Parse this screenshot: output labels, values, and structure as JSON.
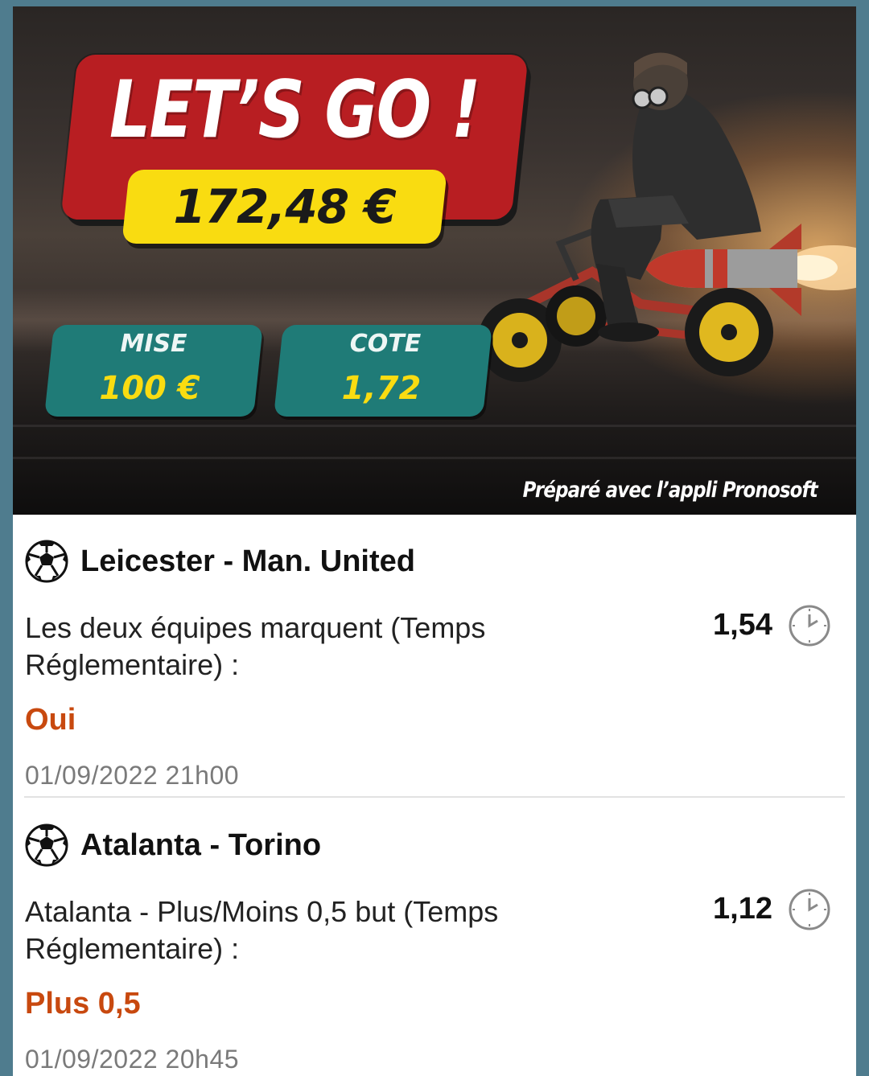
{
  "banner": {
    "headline": "LET’S GO !",
    "amount": "172,48 €",
    "stake": {
      "label": "MISE",
      "value": "100 €"
    },
    "odds": {
      "label": "COTE",
      "value": "1,72"
    },
    "credit": "Préparé avec l’appli Pronosoft",
    "colors": {
      "headline_bg": "#b81e22",
      "amount_bg": "#f9dc11",
      "tile_bg": "#1f7b77"
    }
  },
  "bets": [
    {
      "icon": "soccer-ball-icon",
      "match": "Leicester - Man. United",
      "market": "Les deux équipes marquent (Temps Réglementaire) :",
      "selection": "Oui",
      "odds": "1,54",
      "status_icon": "clock-icon",
      "datetime": "01/09/2022 21h00"
    },
    {
      "icon": "soccer-ball-icon",
      "match": "Atalanta - Torino",
      "market": "Atalanta - Plus/Moins 0,5 but (Temps Réglementaire) :",
      "selection": "Plus 0,5",
      "odds": "1,12",
      "status_icon": "clock-icon",
      "datetime": "01/09/2022 20h45"
    }
  ],
  "colors": {
    "selection": "#c8490f",
    "frame": "#4f7c8e"
  }
}
